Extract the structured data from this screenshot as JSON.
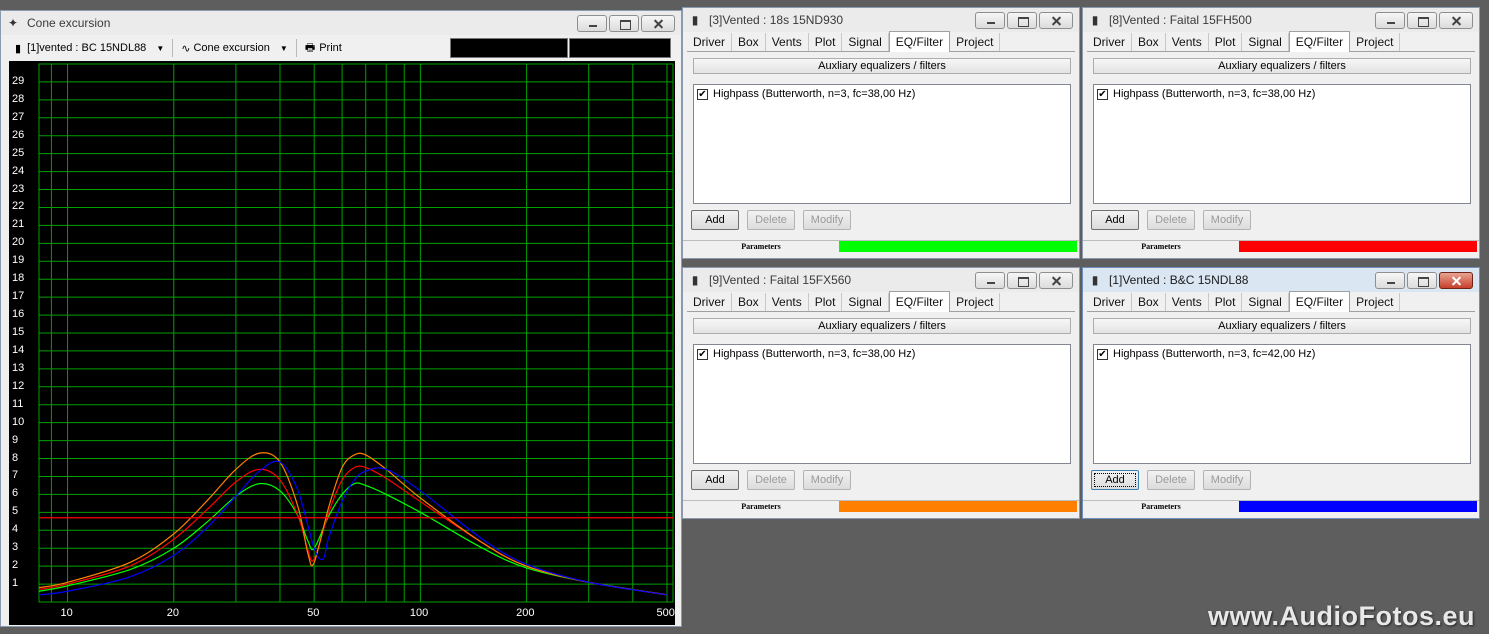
{
  "graph_window": {
    "title": "Cone excursion",
    "toolbar": {
      "project_select": "[1]vented : BC 15NDL88",
      "plot_select": "Cone excursion",
      "print_label": "Print"
    }
  },
  "eq_windows": [
    {
      "title": "[3]Vented : 18s 15ND930",
      "filter": "Highpass (Butterworth, n=3, fc=38,00 Hz)",
      "param_color": "#00ff00",
      "active": false
    },
    {
      "title": "[8]Vented : Faital 15FH500",
      "filter": "Highpass (Butterworth, n=3, fc=38,00 Hz)",
      "param_color": "#ff0000",
      "active": false
    },
    {
      "title": "[9]Vented : Faital 15FX560",
      "filter": "Highpass (Butterworth, n=3, fc=38,00 Hz)",
      "param_color": "#ff8000",
      "active": false
    },
    {
      "title": "[1]Vented : B&C 15NDL88",
      "filter": "Highpass (Butterworth, n=3, fc=42,00 Hz)",
      "param_color": "#0000ff",
      "active": true
    }
  ],
  "tabs": [
    "Driver",
    "Box",
    "Vents",
    "Plot",
    "Signal",
    "EQ/Filter",
    "Project"
  ],
  "selected_tab": "EQ/Filter",
  "subheader": "Auxliary equalizers / filters",
  "buttons": {
    "add": "Add",
    "delete": "Delete",
    "modify": "Modify"
  },
  "parameters_label": "Parameters",
  "watermark": "www.AudioFotos.eu",
  "chart_data": {
    "type": "line",
    "x_scale": "log",
    "xlim": [
      8.3,
      520
    ],
    "ylim": [
      0,
      30
    ],
    "x_ticks": [
      "10",
      "20",
      "50",
      "100",
      "200",
      "500"
    ],
    "y_ticks": [
      "1",
      "2",
      "3",
      "4",
      "5",
      "6",
      "7",
      "8",
      "9",
      "10",
      "11",
      "12",
      "13",
      "14",
      "15",
      "16",
      "17",
      "18",
      "19",
      "20",
      "21",
      "22",
      "23",
      "24",
      "25",
      "26",
      "27",
      "28",
      "29"
    ],
    "grid": true,
    "series": [
      {
        "color": "#00ff00",
        "x": [
          8.3,
          10,
          15,
          20,
          25,
          30,
          35,
          40,
          45,
          48,
          50,
          55,
          60,
          65,
          70,
          80,
          100,
          150,
          200,
          300,
          500
        ],
        "values": [
          0.6,
          0.9,
          1.8,
          3.0,
          4.5,
          5.9,
          6.6,
          6.2,
          4.8,
          3.4,
          3.0,
          4.8,
          6.0,
          6.6,
          6.5,
          6.0,
          5.0,
          3.0,
          1.9,
          1.1,
          0.4
        ]
      },
      {
        "color": "#ff0000",
        "x": [
          8.3,
          10,
          15,
          20,
          25,
          30,
          35,
          40,
          45,
          48,
          50,
          55,
          60,
          65,
          70,
          80,
          100,
          150,
          200,
          300,
          500
        ],
        "values": [
          0.7,
          1.0,
          2.0,
          3.5,
          5.2,
          6.7,
          7.4,
          6.8,
          4.8,
          2.9,
          2.4,
          5.0,
          6.8,
          7.5,
          7.5,
          6.9,
          5.6,
          3.3,
          2.0,
          1.1,
          0.4
        ]
      },
      {
        "color": "#ff8000",
        "x": [
          8.3,
          10,
          15,
          20,
          25,
          30,
          35,
          40,
          45,
          48,
          50,
          55,
          60,
          65,
          70,
          80,
          100,
          150,
          200,
          300,
          500
        ],
        "values": [
          0.8,
          1.1,
          2.2,
          3.8,
          5.7,
          7.4,
          8.3,
          7.8,
          5.3,
          2.7,
          2.2,
          5.3,
          7.5,
          8.2,
          8.2,
          7.4,
          5.8,
          3.3,
          2.0,
          1.1,
          0.4
        ]
      },
      {
        "color": "#0000ff",
        "x": [
          8.3,
          10,
          15,
          20,
          25,
          30,
          35,
          40,
          45,
          50,
          53,
          55,
          60,
          65,
          70,
          80,
          100,
          150,
          200,
          300,
          500
        ],
        "values": [
          0.4,
          0.6,
          1.4,
          2.6,
          4.2,
          5.9,
          7.3,
          7.8,
          6.2,
          3.0,
          2.4,
          3.6,
          5.6,
          6.8,
          7.3,
          7.4,
          6.2,
          3.5,
          2.1,
          1.1,
          0.4
        ]
      },
      {
        "color": "#ff0000",
        "x": [
          8.3,
          520
        ],
        "values": [
          4.7,
          4.7
        ]
      }
    ]
  }
}
